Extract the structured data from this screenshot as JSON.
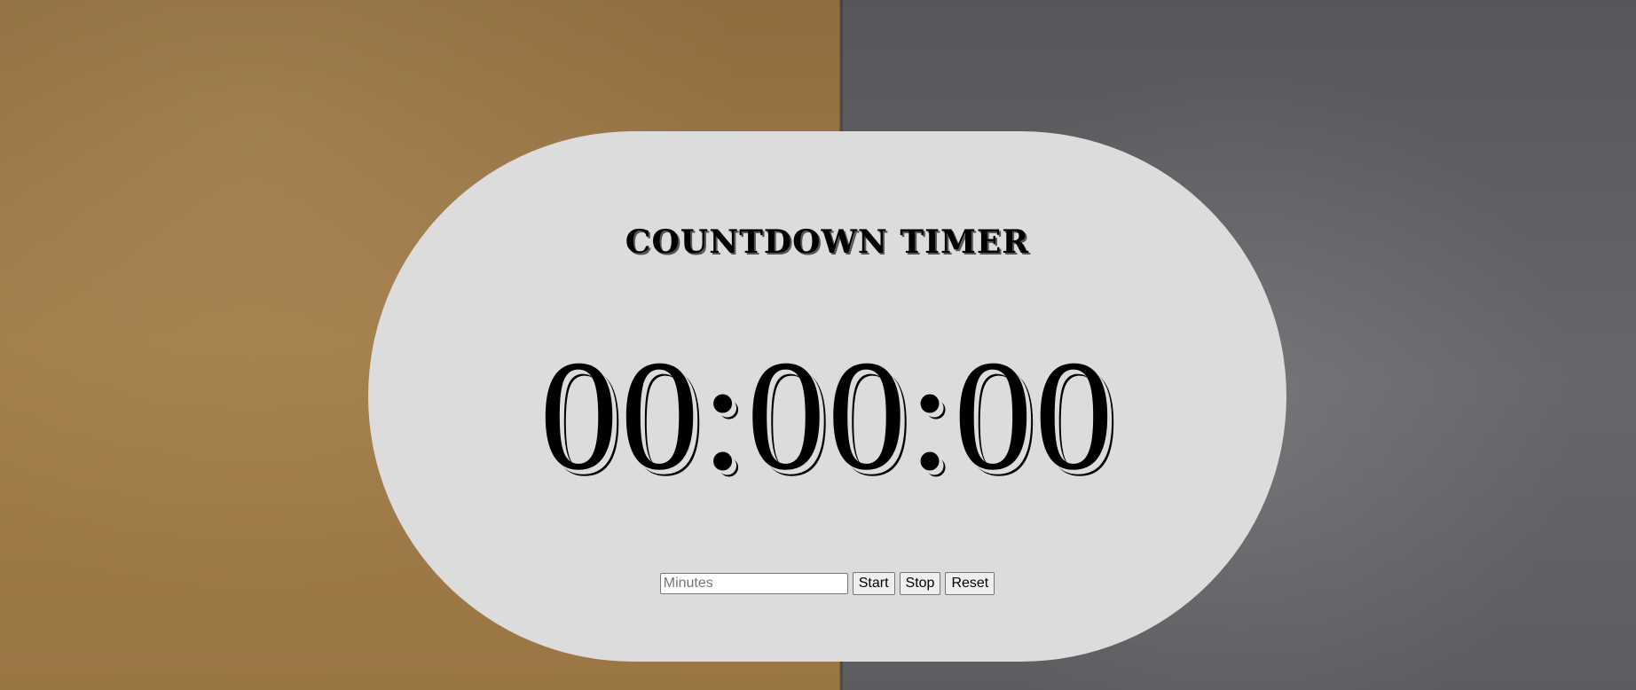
{
  "timer": {
    "title": "COUNTDOWN TIMER",
    "display": "00:00:00"
  },
  "controls": {
    "minutes_placeholder": "Minutes",
    "minutes_value": "",
    "start_label": "Start",
    "stop_label": "Stop",
    "reset_label": "Reset"
  },
  "colors": {
    "background_left": "#9a7748",
    "background_right": "#5d5e60",
    "panel": "#dcdcdc",
    "text": "#000000"
  }
}
